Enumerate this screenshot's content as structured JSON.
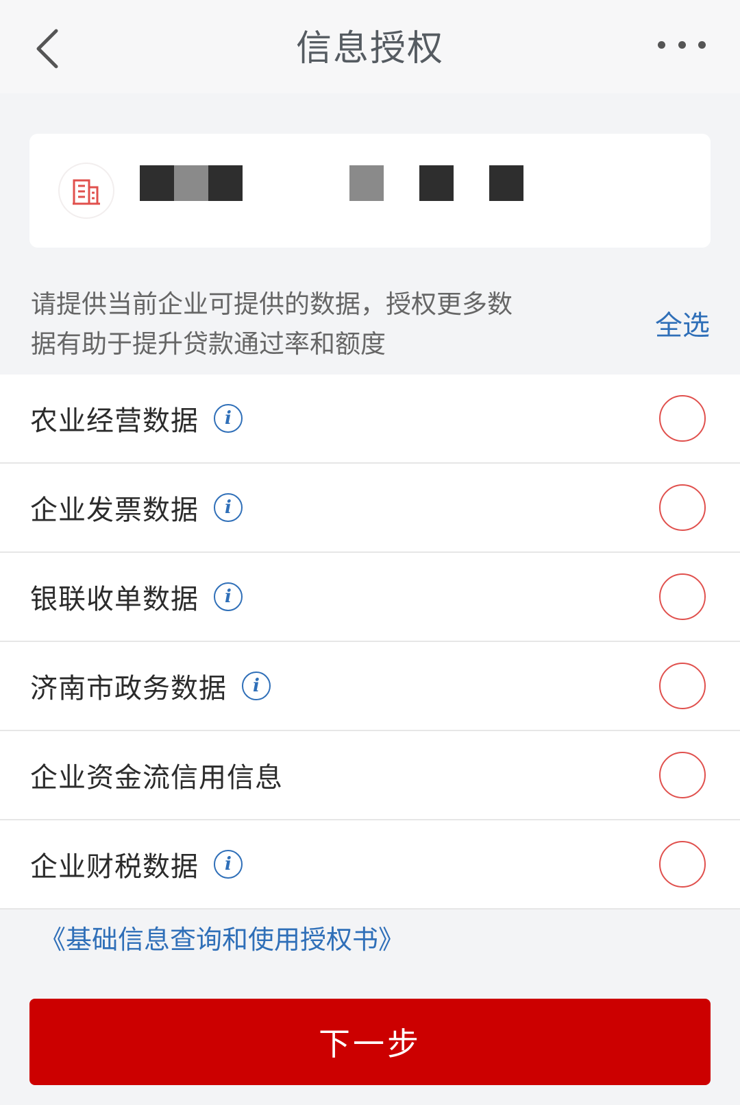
{
  "header": {
    "title": "信息授权"
  },
  "hint": {
    "line1": "请提供当前企业可提供的数据，授权更多数",
    "line2": "据有助于提升贷款通过率和额度",
    "select_all": "全选"
  },
  "items": [
    {
      "label": "农业经营数据",
      "has_info": true
    },
    {
      "label": "企业发票数据",
      "has_info": true
    },
    {
      "label": "银联收单数据",
      "has_info": true
    },
    {
      "label": "济南市政务数据",
      "has_info": true
    },
    {
      "label": "企业资金流信用信息",
      "has_info": false
    },
    {
      "label": "企业财税数据",
      "has_info": true
    }
  ],
  "info_glyph": "i",
  "agreement": "《基础信息查询和使用授权书》",
  "next_button": "下一步",
  "colors": {
    "accent_blue": "#2f6fb8",
    "radio_red": "#e0504d",
    "button_red": "#cc0000"
  }
}
